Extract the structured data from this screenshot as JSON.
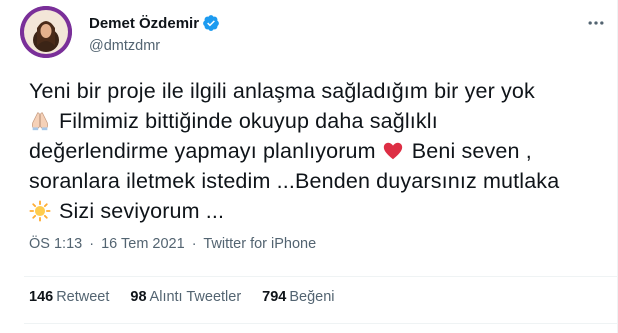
{
  "author": {
    "display_name": "Demet Özdemir",
    "handle": "@dmtzdmr",
    "verified": true,
    "avatar_icon": "avatar-icon"
  },
  "tweet": {
    "lines": [
      {
        "emoji": "",
        "text": "Yeni bir proje ile ilgili anlaşma sağladığım bir yer yok",
        "emoji_after": "",
        "text_after": ""
      },
      {
        "emoji": "folded-hands-emoji",
        "text": "Filmimiz bittiğinde okuyup daha sağlıklı",
        "emoji_after": "",
        "text_after": ""
      },
      {
        "emoji": "",
        "text": "değerlendirme yapmayı planlıyorum",
        "emoji_after": "red-heart-emoji",
        "text_after": "Beni seven ,"
      },
      {
        "emoji": "",
        "text": "soranlara iletmek istedim ...Benden duyarsınız mutlaka",
        "emoji_after": "",
        "text_after": ""
      },
      {
        "emoji": "sun-emoji",
        "text": "Sizi seviyorum ...",
        "emoji_after": "",
        "text_after": ""
      }
    ]
  },
  "meta": {
    "time": "ÖS 1:13",
    "separator": "·",
    "date": "16 Tem 2021",
    "source": "Twitter for iPhone"
  },
  "stats": {
    "retweets_count": "146",
    "retweets_label": "Retweet",
    "quotes_count": "98",
    "quotes_label": "Alıntı Tweetler",
    "likes_count": "794",
    "likes_label": "Beğeni"
  },
  "colors": {
    "text_primary": "#0f1419",
    "text_secondary": "#536471",
    "verified_blue": "#1d9bf0",
    "heart_red": "#e0245e",
    "sun_yellow": "#ffcc33"
  }
}
